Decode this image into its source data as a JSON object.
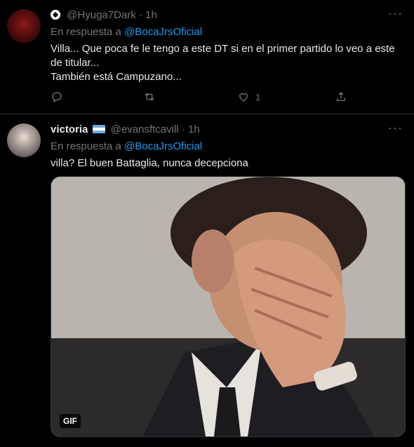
{
  "tweets": [
    {
      "display_name": "",
      "handle": "@Hyuga7Dark",
      "sep": "·",
      "time": "1h",
      "reply_prefix": "En respuesta a",
      "reply_to": "@BocaJrsOficial",
      "text_lines": [
        "Villa... Que poca fe le tengo a este DT si en el primer partido lo veo a este",
        "de titular...",
        "También está Campuzano..."
      ],
      "like_count": "1"
    },
    {
      "display_name": "victoria",
      "handle": "@evansftcavill",
      "sep": "·",
      "time": "1h",
      "reply_prefix": "En respuesta a",
      "reply_to": "@BocaJrsOficial",
      "text_lines": [
        "villa? El buen Battaglia, nunca decepciona"
      ],
      "media_badge": "GIF"
    }
  ],
  "icons": {
    "more": "more-horizontal-icon",
    "reply": "reply-icon",
    "retweet": "retweet-icon",
    "like": "heart-icon",
    "share": "share-icon",
    "name_emoji_1": "soccer-ball-icon",
    "name_emoji_2": "argentina-flag-icon"
  },
  "colors": {
    "background": "#000000",
    "link": "#1d9bf0",
    "muted": "#71767b",
    "text": "#e7e9ea"
  }
}
